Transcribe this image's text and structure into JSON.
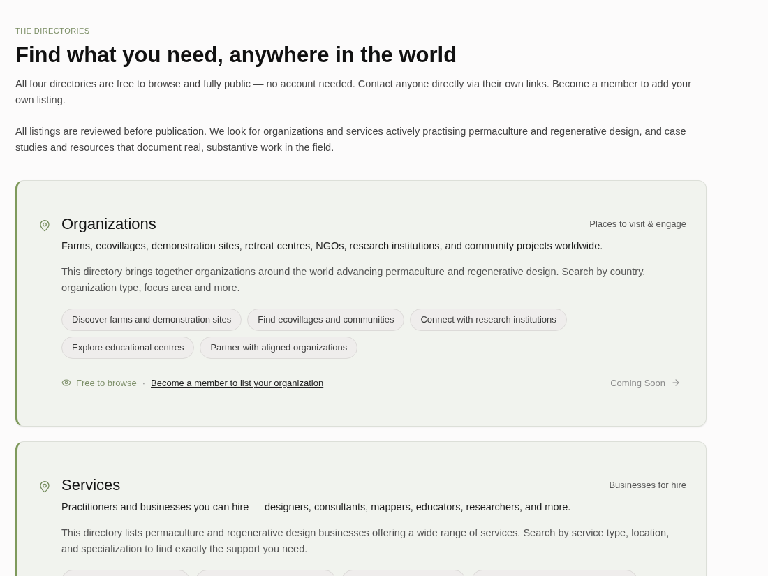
{
  "header": {
    "eyebrow": "THE DIRECTORIES",
    "title": "Find what you need, anywhere in the world",
    "paragraphs": [
      "All four directories are free to browse and fully public — no account needed. Contact anyone directly via their own links. Become a member to add your own listing.",
      "All listings are reviewed before publication. We look for organizations and services actively practising permaculture and regenerative design, and case studies and resources that document real, substantive work in the field."
    ]
  },
  "directories": [
    {
      "title": "Organizations",
      "tagline": "Places to visit & engage",
      "summary": "Farms, ecovillages, demonstration sites, retreat centres, NGOs, research institutions, and community projects worldwide.",
      "description": "This directory brings together organizations around the world advancing permaculture and regenerative design. Search by country, organization type, focus area and more.",
      "tags": [
        {
          "kind": "label",
          "label": "Discover farms and demonstration sites"
        },
        {
          "kind": "label",
          "label": "Find ecovillages and communities"
        },
        {
          "kind": "label",
          "label": "Connect with research institutions"
        },
        {
          "kind": "label",
          "label": "Explore educational centres"
        },
        {
          "kind": "label",
          "label": "Partner with aligned organizations"
        }
      ],
      "footer": {
        "access": "Free to browse",
        "separator": "·",
        "member_link": "Become a member to list your organization",
        "status": "Coming Soon"
      }
    },
    {
      "title": "Services",
      "tagline": "Businesses for hire",
      "summary": "Practitioners and businesses you can hire — designers, consultants, mappers, educators, researchers, and more.",
      "description": "This directory lists permaculture and regenerative design businesses offering a wide range of services. Search by service type, location, and specialization to find exactly the support you need.",
      "tags": [
        {
          "kind": "cut_off"
        },
        {
          "kind": "cut_off"
        },
        {
          "kind": "cut_off"
        },
        {
          "kind": "cut_off"
        }
      ]
    }
  ]
}
